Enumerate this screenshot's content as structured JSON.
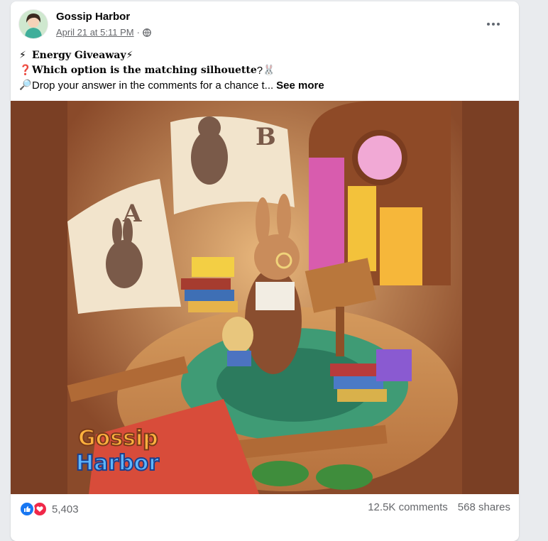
{
  "post": {
    "page_name": "Gossip Harbor",
    "date": "April 21 at 5:11 PM",
    "separator": "·",
    "privacy_icon": "globe-icon"
  },
  "text": {
    "line1": {
      "emoji_left": "⚡",
      "text": "Energy Giveaway",
      "emoji_right": "⚡"
    },
    "line2": {
      "emoji_left": "❓",
      "text": "Which option is the matching silhouette",
      "suffix": "?",
      "emoji_right": "🐰"
    },
    "line3": {
      "emoji_left": "🔎",
      "text": "Drop your answer in the comments for a chance t...",
      "see_more": "See more"
    }
  },
  "image": {
    "option_a": "A",
    "option_b": "B",
    "logo_line1": "Gossip",
    "logo_line2": "Harbor"
  },
  "footer": {
    "reaction_icons": [
      "like-icon",
      "love-icon"
    ],
    "reactions_count": "5,403",
    "comments": "12.5K comments",
    "shares": "568 shares"
  }
}
